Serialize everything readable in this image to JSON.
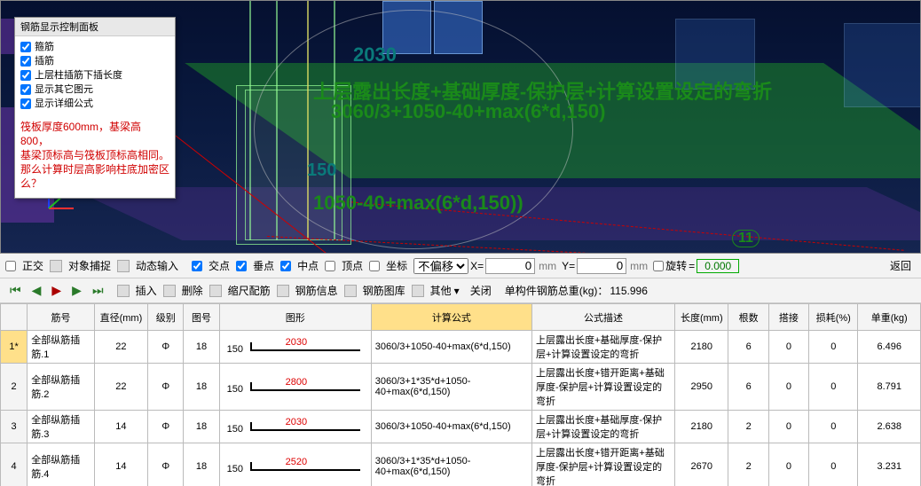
{
  "panel": {
    "title": "钢筋显示控制面板",
    "options": [
      "箍筋",
      "插筋",
      "上层柱插筋下插长度",
      "显示其它图元",
      "显示详细公式"
    ],
    "note_lines": [
      "筏板厚度600mm，基梁高800，",
      "基梁顶标高与筏板顶标高相同。",
      "那么计算时层高影响柱底加密区么？"
    ]
  },
  "overlay": {
    "dim_2030": "2030",
    "line1": "上层露出长度+基础厚度-保护层+计算设置设定的弯折",
    "line2": "3060/3+1050-40+max(6*d,150)",
    "line3": "1050-40+max(6*d,150))",
    "dim_150": "150",
    "label_11": "11"
  },
  "toolbar1": {
    "ortho": "正交",
    "osnap": "对象捕捉",
    "dyninput": "动态输入",
    "intersect": "交点",
    "perp": "垂点",
    "mid": "中点",
    "apex": "顶点",
    "coord": "坐标",
    "nooffset": "不偏移",
    "x_lbl": "X=",
    "y_lbl": "Y=",
    "x_val": "0",
    "y_val": "0",
    "mm": "mm",
    "rotate": "旋转",
    "rot_val": "0.000",
    "back": "返回"
  },
  "toolbar2": {
    "first": "⏮",
    "prev": "◀",
    "play": "▶",
    "next": "▶",
    "last": "⏭",
    "insert": "插入",
    "delete": "删除",
    "scale": "缩尺配筋",
    "info": "钢筋信息",
    "library": "钢筋图库",
    "other": "其他",
    "close": "关闭",
    "weight_lbl": "单构件钢筋总重(kg)：",
    "weight_val": "115.996"
  },
  "table": {
    "headers": [
      "",
      "筋号",
      "直径(mm)",
      "级别",
      "图号",
      "图形",
      "计算公式",
      "公式描述",
      "长度(mm)",
      "根数",
      "搭接",
      "损耗(%)",
      "单重(kg)"
    ],
    "rows": [
      {
        "n": "1*",
        "name": "全部纵筋插筋.1",
        "dia": "22",
        "grade": "Φ",
        "fig": "18",
        "h": "150",
        "top": "2030",
        "formula": "3060/3+1050-40+max(6*d,150)",
        "desc": "上层露出长度+基础厚度-保护层+计算设置设定的弯折",
        "len": "2180",
        "qty": "6",
        "lap": "0",
        "loss": "0",
        "wt": "6.496"
      },
      {
        "n": "2",
        "name": "全部纵筋插筋.2",
        "dia": "22",
        "grade": "Φ",
        "fig": "18",
        "h": "150",
        "top": "2800",
        "formula": "3060/3+1*35*d+1050-40+max(6*d,150)",
        "desc": "上层露出长度+错开距离+基础厚度-保护层+计算设置设定的弯折",
        "len": "2950",
        "qty": "6",
        "lap": "0",
        "loss": "0",
        "wt": "8.791"
      },
      {
        "n": "3",
        "name": "全部纵筋插筋.3",
        "dia": "14",
        "grade": "Φ",
        "fig": "18",
        "h": "150",
        "top": "2030",
        "formula": "3060/3+1050-40+max(6*d,150)",
        "desc": "上层露出长度+基础厚度-保护层+计算设置设定的弯折",
        "len": "2180",
        "qty": "2",
        "lap": "0",
        "loss": "0",
        "wt": "2.638"
      },
      {
        "n": "4",
        "name": "全部纵筋插筋.4",
        "dia": "14",
        "grade": "Φ",
        "fig": "18",
        "h": "150",
        "top": "2520",
        "formula": "3060/3+1*35*d+1050-40+max(6*d,150)",
        "desc": "上层露出长度+错开距离+基础厚度-保护层+计算设置设定的弯折",
        "len": "2670",
        "qty": "2",
        "lap": "0",
        "loss": "0",
        "wt": "3.231"
      }
    ]
  }
}
